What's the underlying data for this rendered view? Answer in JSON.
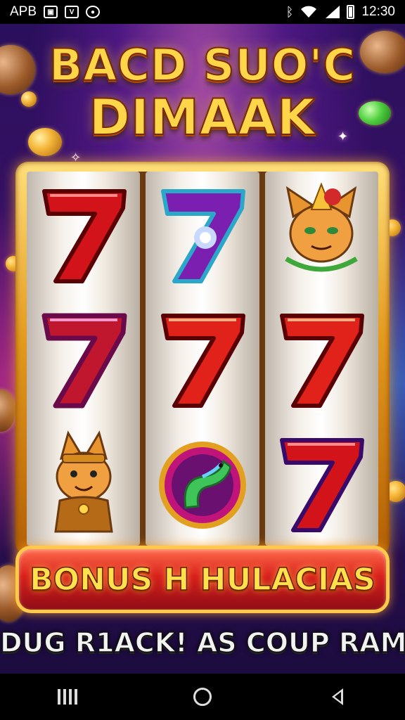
{
  "status_bar": {
    "carrier": "APB",
    "time": "12:30",
    "icons": [
      "app-notification-icon",
      "vine-notification-icon",
      "circle-notification-icon",
      "bluetooth-icon",
      "wifi-icon",
      "signal-icon",
      "battery-icon"
    ]
  },
  "game": {
    "title_line1": "BACD SUO'C",
    "title_line2": "DIMAAK",
    "reels": [
      {
        "symbols": [
          "red-seven",
          "red-seven",
          "cat-mascot"
        ]
      },
      {
        "symbols": [
          "purple-seven",
          "red-seven",
          "serpent-emblem"
        ]
      },
      {
        "symbols": [
          "cat-warrior-mascot",
          "red-seven",
          "red-seven"
        ]
      }
    ],
    "bonus_label": "BONUS H HULACIAS",
    "tagline": "DUG R1ACK! AS COUP RAM!"
  },
  "nav_bar": {
    "buttons": [
      "recents",
      "home",
      "back"
    ]
  },
  "colors": {
    "accent_gold": "#ffd64a",
    "bonus_red": "#d8201c",
    "seven_red": "#d2141a",
    "seven_purple": "#7a1fb0"
  }
}
